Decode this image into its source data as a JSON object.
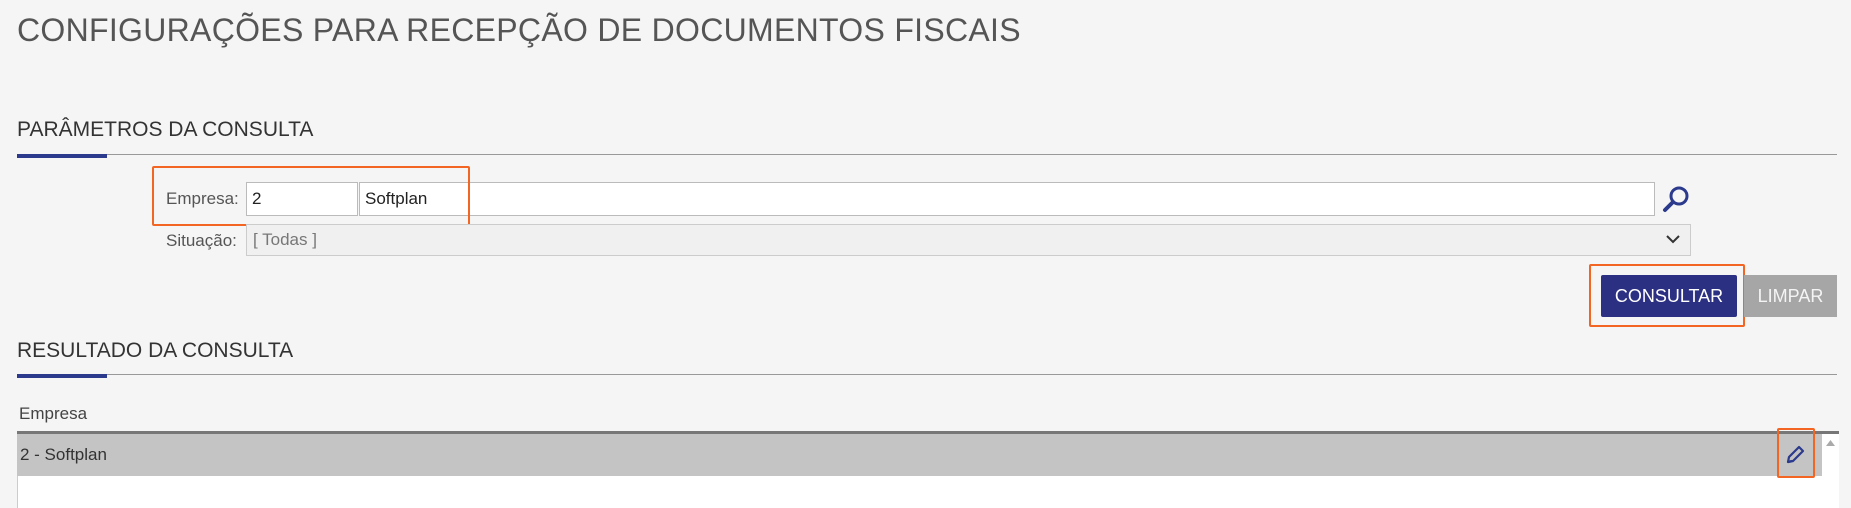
{
  "page": {
    "title": "CONFIGURAÇÕES PARA RECEPÇÃO DE DOCUMENTOS FISCAIS"
  },
  "params": {
    "section_title": "PARÂMETROS DA CONSULTA",
    "empresa_label": "Empresa:",
    "empresa_code": "2",
    "empresa_name": "Softplan",
    "situacao_label": "Situação:",
    "situacao_value": "[ Todas ]",
    "search_icon": "magnifier-icon",
    "dropdown_icon": "chevron-down-icon"
  },
  "actions": {
    "consultar": "CONSULTAR",
    "limpar": "LIMPAR"
  },
  "results": {
    "section_title": "RESULTADO DA CONSULTA",
    "columns": [
      "Empresa"
    ],
    "rows": [
      {
        "empresa": "2 - Softplan"
      }
    ],
    "edit_icon": "pencil-icon"
  },
  "colors": {
    "accent": "#2b3a8c",
    "primary_button": "#2b3082",
    "secondary_button": "#a6a6a6",
    "highlight": "#f26522",
    "selected_row": "#c4c4c4"
  }
}
